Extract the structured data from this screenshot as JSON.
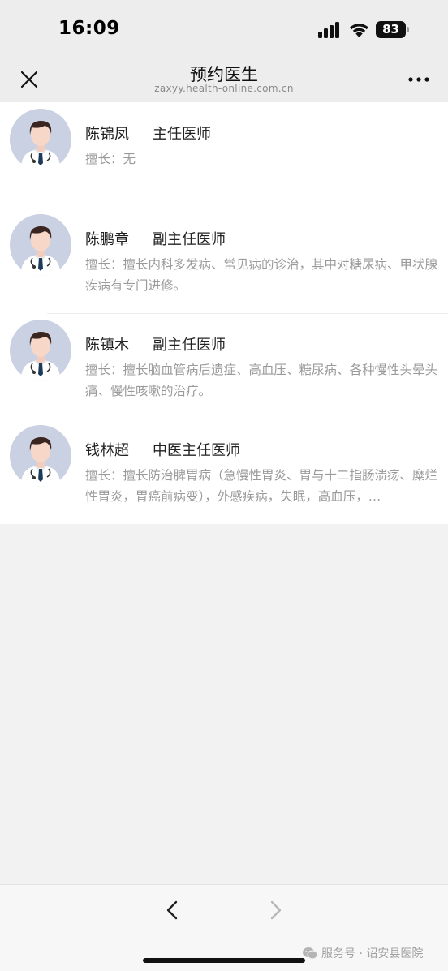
{
  "status_bar": {
    "time": "16:09",
    "battery": "83"
  },
  "header": {
    "title": "预约医生",
    "url": "zaxyy.health-online.com.cn"
  },
  "doctors": [
    {
      "name": "陈锦凤",
      "title": "主任医师",
      "specialty": "擅长：无"
    },
    {
      "name": "陈鹏章",
      "title": "副主任医师",
      "specialty": "擅长：擅长内科多发病、常见病的诊治，其中对糖尿病、甲状腺疾病有专门进修。"
    },
    {
      "name": "陈镇木",
      "title": "副主任医师",
      "specialty": "擅长：擅长脑血管病后遗症、高血压、糖尿病、各种慢性头晕头痛、慢性咳嗽的治疗。"
    },
    {
      "name": "钱林超",
      "title": "中医主任医师",
      "specialty": "擅长：擅长防治脾胃病（急慢性胃炎、胃与十二指肠溃疡、糜烂性胃炎，胃癌前病变），外感疾病，失眠，高血压，…"
    }
  ],
  "icons": {
    "close": "close-icon",
    "more": "more-icon",
    "avatar": "doctor-avatar-icon",
    "back": "chevron-left-icon",
    "forward": "chevron-right-icon",
    "wechat": "wechat-icon"
  },
  "watermark": {
    "text": "服务号 · 诏安县医院"
  },
  "colors": {
    "background": "#f2f2f2",
    "header": "#ededed",
    "card": "#ffffff",
    "secondary_text": "#9a9a9a"
  }
}
